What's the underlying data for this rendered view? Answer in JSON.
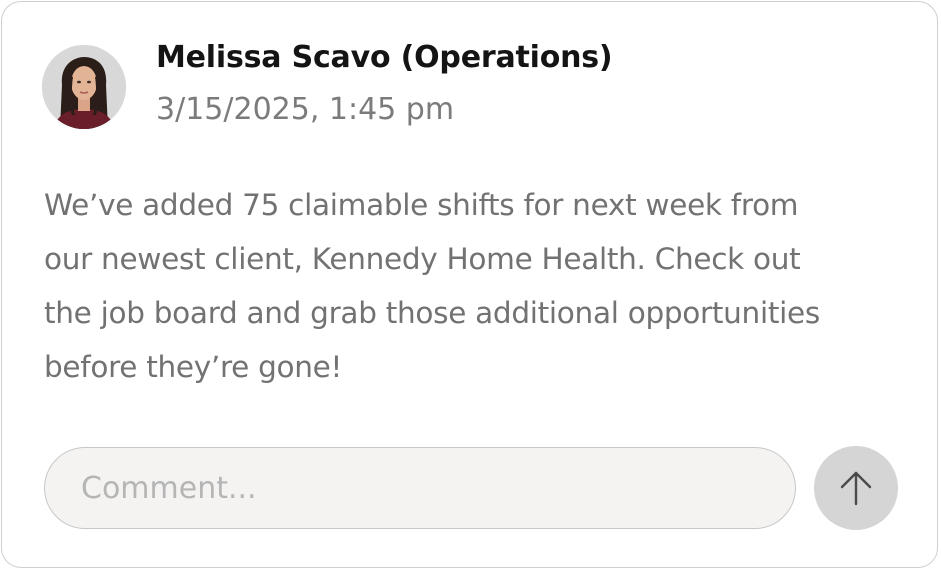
{
  "post": {
    "author": "Melissa Scavo (Operations)",
    "timestamp": "3/15/2025, 1:45 pm",
    "body": "We’ve added 75 claimable shifts for next week from\nour newest client, Kennedy Home Health. Check out\nthe job board and grab those additional  opportunities\nbefore they’re gone!"
  },
  "comment": {
    "placeholder": "Comment..."
  },
  "icons": {
    "send": "arrow-up-icon",
    "avatar": "user-avatar"
  },
  "colors": {
    "send_button_bg": "#d5d5d5",
    "input_bg": "#f4f3f2"
  }
}
